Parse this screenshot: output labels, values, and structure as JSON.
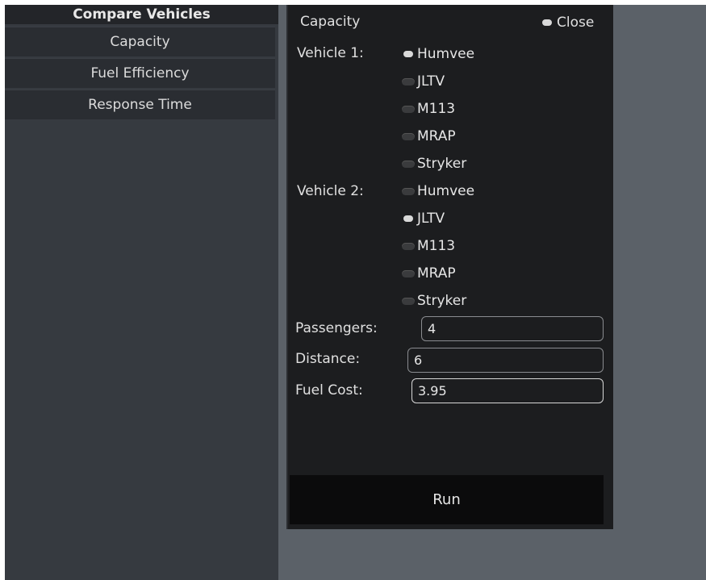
{
  "sidebar": {
    "title": "Compare Vehicles",
    "items": [
      {
        "label": "Capacity"
      },
      {
        "label": "Fuel Efficiency"
      },
      {
        "label": "Response Time"
      }
    ]
  },
  "panel": {
    "title": "Capacity",
    "close_label": "Close",
    "vehicle1": {
      "label": "Vehicle 1:",
      "options": [
        "Humvee",
        "JLTV",
        "M113",
        "MRAP",
        "Stryker"
      ],
      "selected": "Humvee"
    },
    "vehicle2": {
      "label": "Vehicle 2:",
      "options": [
        "Humvee",
        "JLTV",
        "M113",
        "MRAP",
        "Stryker"
      ],
      "selected": "JLTV"
    },
    "fields": {
      "passengers": {
        "label": "Passengers:",
        "value": "4"
      },
      "distance": {
        "label": "Distance:",
        "value": "6"
      },
      "fuel_cost": {
        "label": "Fuel Cost:",
        "value": "3.95"
      }
    },
    "run_label": "Run"
  }
}
